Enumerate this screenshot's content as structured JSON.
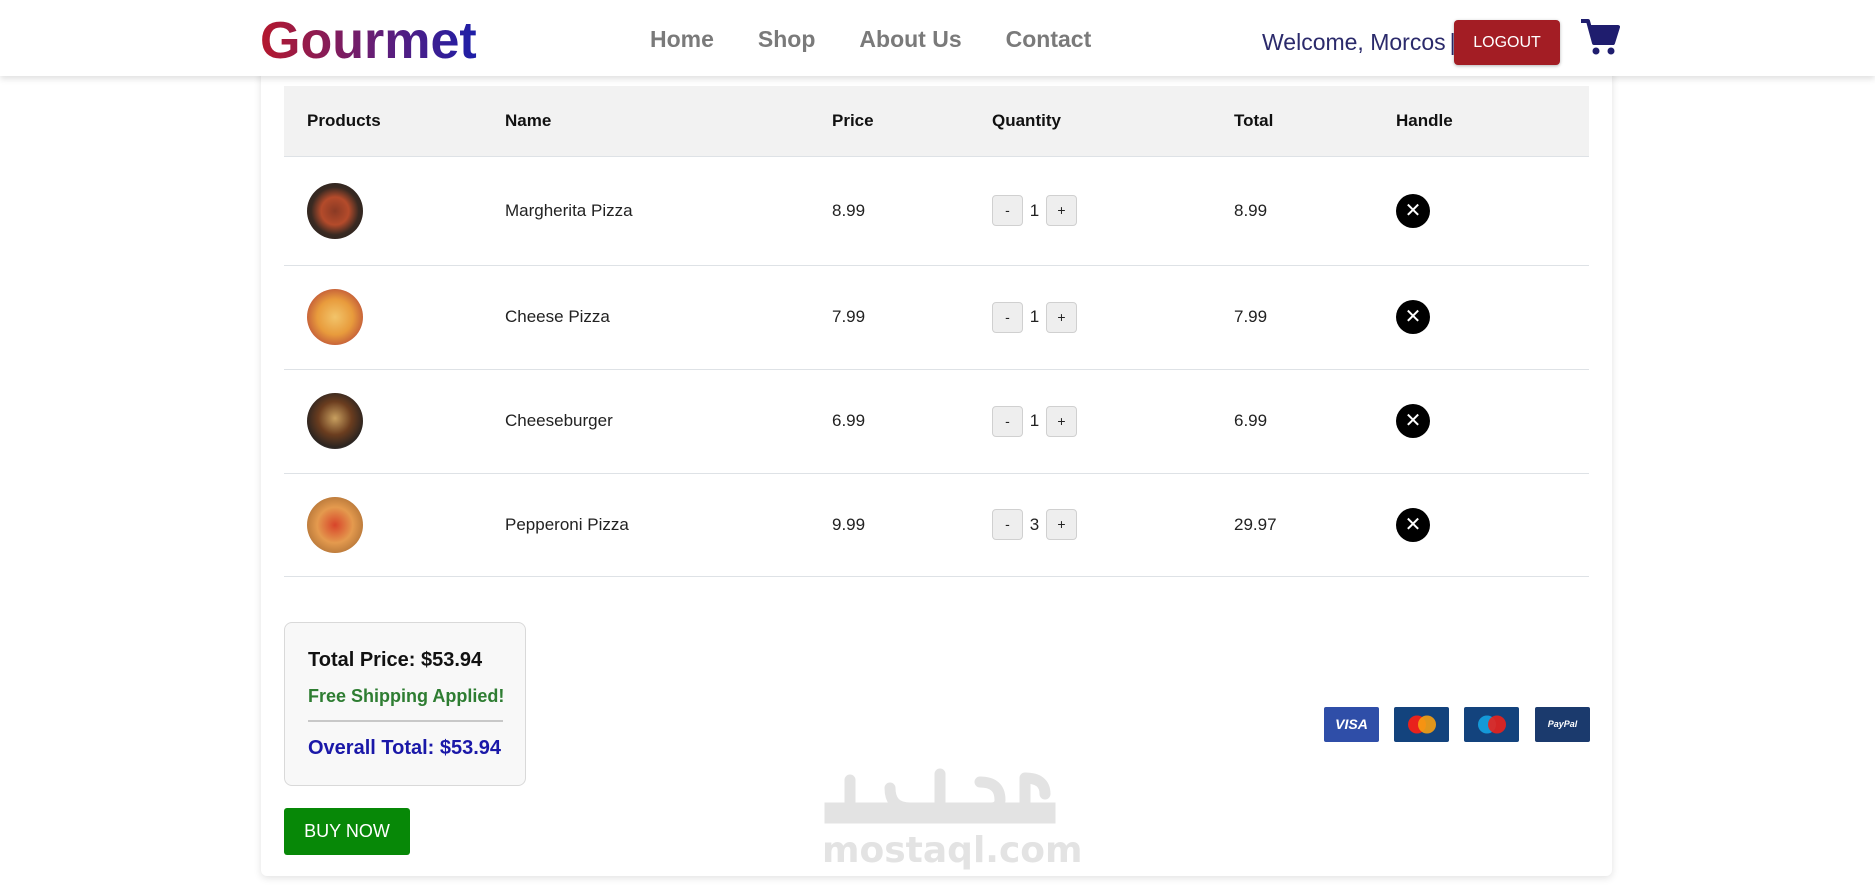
{
  "navbar": {
    "brand": "Gourmet",
    "links": [
      "Home",
      "Shop",
      "About Us",
      "Contact"
    ],
    "welcome": "Welcome, Morcos",
    "separator": "|",
    "logout_label": "LOGOUT",
    "cart_icon": "shopping-cart-icon"
  },
  "cart": {
    "headers": [
      "Products",
      "Name",
      "Price",
      "Quantity",
      "Total",
      "Handle"
    ],
    "rows": [
      {
        "name": "Margherita Pizza",
        "price": "8.99",
        "quantity": "1",
        "total": "8.99"
      },
      {
        "name": "Cheese Pizza",
        "price": "7.99",
        "quantity": "1",
        "total": "7.99"
      },
      {
        "name": "Cheeseburger",
        "price": "6.99",
        "quantity": "1",
        "total": "6.99"
      },
      {
        "name": "Pepperoni Pizza",
        "price": "9.99",
        "quantity": "3",
        "total": "29.97"
      }
    ],
    "decrement_label": "-",
    "increment_label": "+",
    "remove_label": "✕"
  },
  "summary": {
    "total_price": "Total Price: $53.94",
    "shipping": "Free Shipping Applied!",
    "overall_total": "Overall Total: $53.94"
  },
  "buy_label": "BUY NOW",
  "payment": {
    "visa": "VISA",
    "paypal": "PayPal"
  },
  "watermark": {
    "latin": "mostaql.com"
  },
  "colors": {
    "logout": "#a31d24",
    "buy": "#078807",
    "shipping": "#2e7d32",
    "overall": "#1a18a8"
  }
}
